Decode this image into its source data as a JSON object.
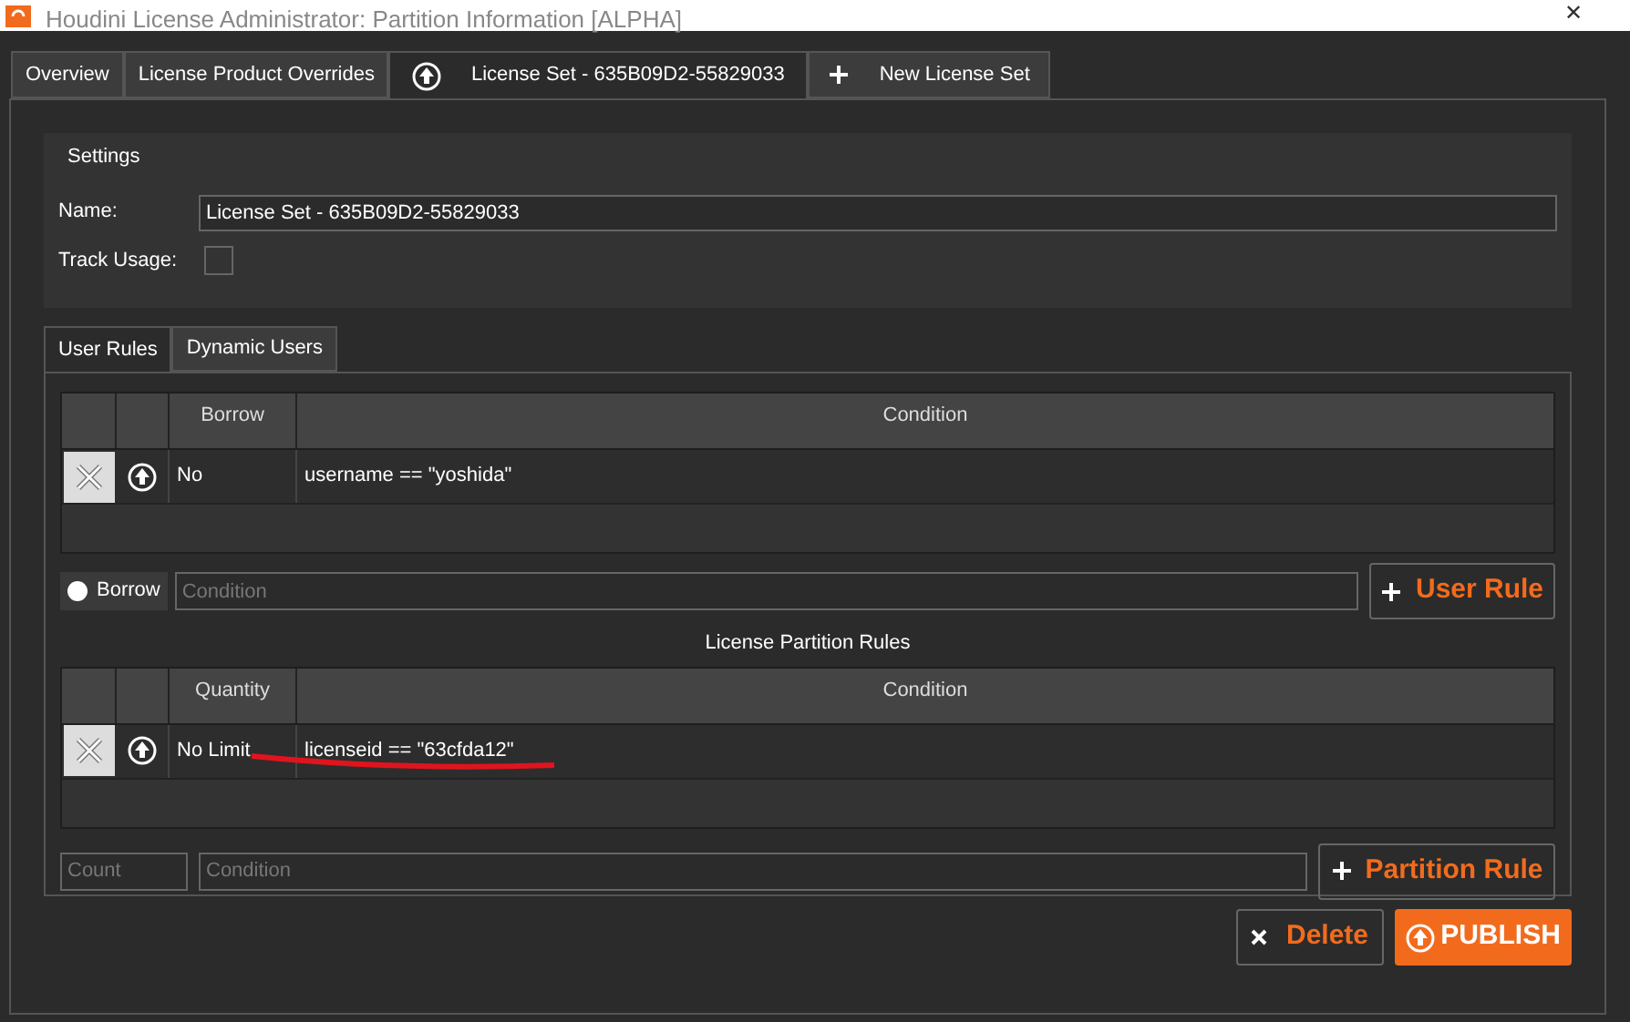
{
  "window": {
    "title": "Houdini License Administrator: Partition Information [ALPHA]",
    "close": "✕"
  },
  "tabs": [
    {
      "label": "Overview",
      "selected": false,
      "kind": "plain"
    },
    {
      "label": "License Product Overrides",
      "selected": false,
      "kind": "plain"
    },
    {
      "label": "License Set - 635B09D2-55829033",
      "selected": true,
      "kind": "publish"
    },
    {
      "label": "New License Set",
      "selected": false,
      "kind": "add"
    }
  ],
  "settings": {
    "title": "Settings",
    "name_label": "Name:",
    "name_value": "License Set - 635B09D2-55829033",
    "track_label": "Track Usage:",
    "track_usage": false
  },
  "inner_tabs": [
    {
      "label": "User Rules",
      "selected": true
    },
    {
      "label": "Dynamic Users",
      "selected": false
    }
  ],
  "user_rules": {
    "columns": [
      "Borrow",
      "Condition"
    ],
    "rows": [
      {
        "col1": "No",
        "condition": "username == \"yoshida\""
      }
    ],
    "borrow": {
      "label": "Borrow",
      "on": false
    },
    "condition_placeholder": "Condition",
    "add_button": "User Rule"
  },
  "partition_rules": {
    "title": "License Partition Rules",
    "columns": [
      "Quantity",
      "Condition"
    ],
    "rows": [
      {
        "col1": "No Limit",
        "condition": "licenseid == \"63cfda12\"",
        "annotated": true
      }
    ],
    "count_placeholder": "Count",
    "condition_placeholder": "Condition",
    "add_button": "Partition Rule"
  },
  "actions": {
    "delete": "Delete",
    "publish": "PUBLISH"
  }
}
